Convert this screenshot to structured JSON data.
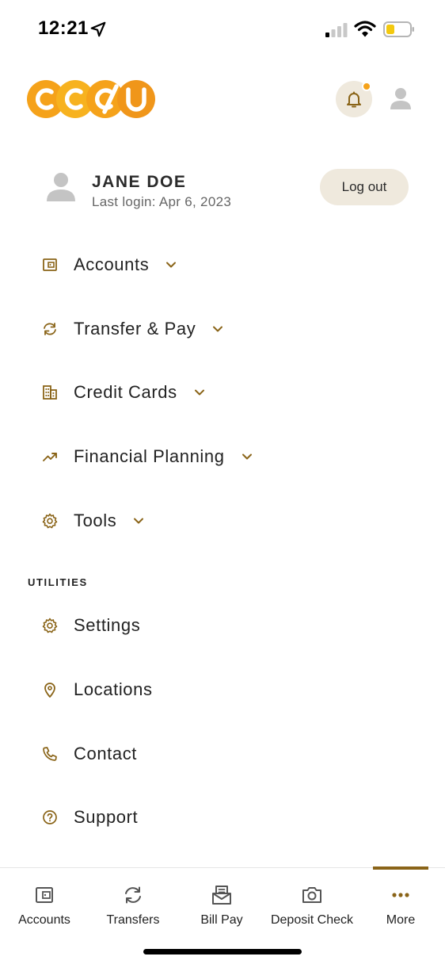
{
  "status_bar": {
    "time": "12:21"
  },
  "header": {
    "logo_text": "CCCU",
    "notification_dot_color": "#f5a21a"
  },
  "user": {
    "name": "JANE DOE",
    "last_login": "Last login: Apr 6, 2023",
    "logout_label": "Log out"
  },
  "menu": {
    "accounts": "Accounts",
    "transfer_pay": "Transfer & Pay",
    "credit_cards": "Credit Cards",
    "financial_planning": "Financial Planning",
    "tools": "Tools"
  },
  "utilities": {
    "heading": "UTILITIES",
    "settings": "Settings",
    "locations": "Locations",
    "contact": "Contact",
    "support": "Support"
  },
  "bottom_nav": {
    "accounts": "Accounts",
    "transfers": "Transfers",
    "bill_pay": "Bill Pay",
    "deposit_check": "Deposit Check",
    "more": "More",
    "active": "More"
  },
  "colors": {
    "accent_brown": "#8a6418",
    "logo_orange": "#f5a21a",
    "pill_background": "#efe9dd"
  }
}
